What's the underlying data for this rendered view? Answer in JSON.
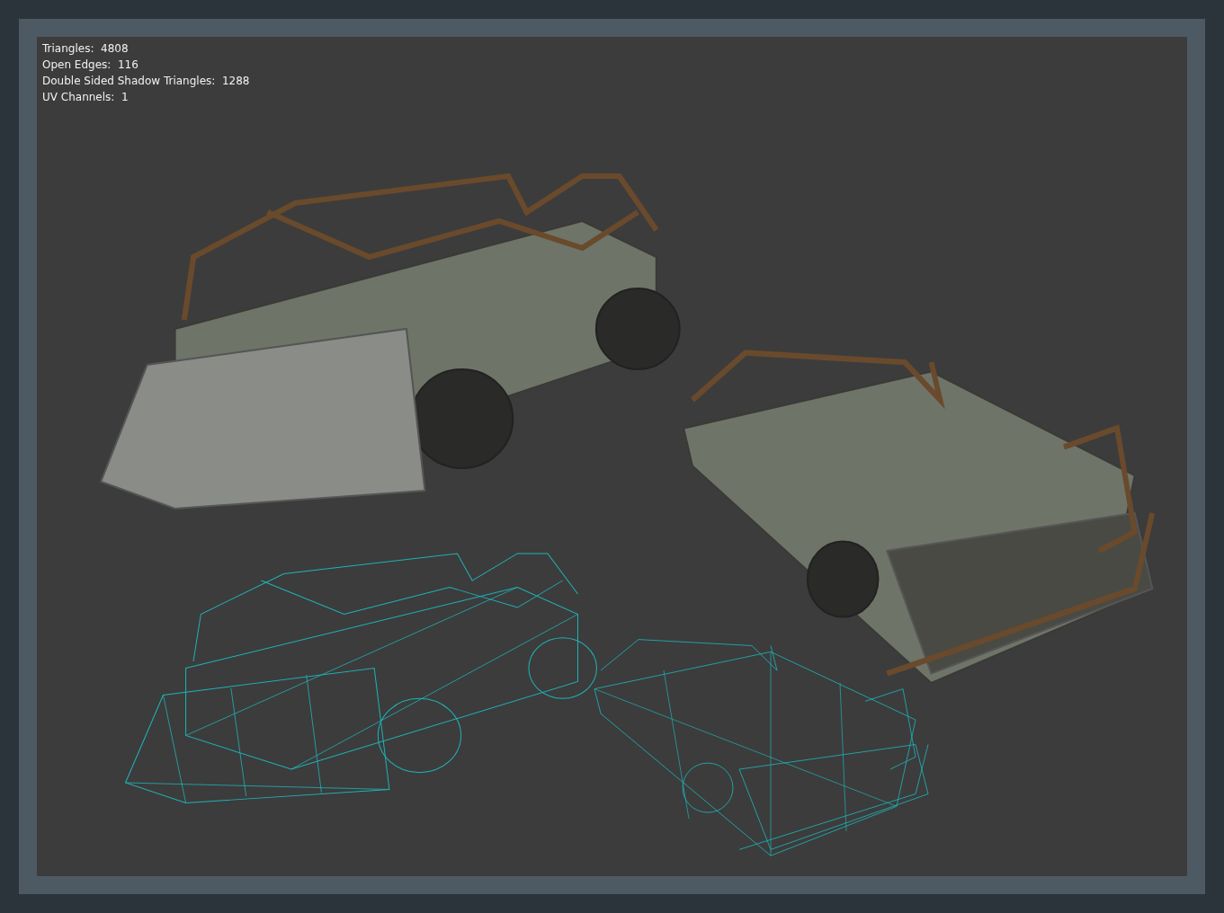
{
  "viewport": {
    "stats": [
      {
        "label": "Triangles:",
        "value": "4808"
      },
      {
        "label": "Open Edges:",
        "value": "116"
      },
      {
        "label": "Double Sided Shadow Triangles:",
        "value": "1288"
      },
      {
        "label": "UV Channels:",
        "value": "1"
      }
    ],
    "objects": [
      {
        "kind": "textured"
      },
      {
        "kind": "textured"
      },
      {
        "kind": "wireframe"
      },
      {
        "kind": "wireframe"
      }
    ]
  }
}
